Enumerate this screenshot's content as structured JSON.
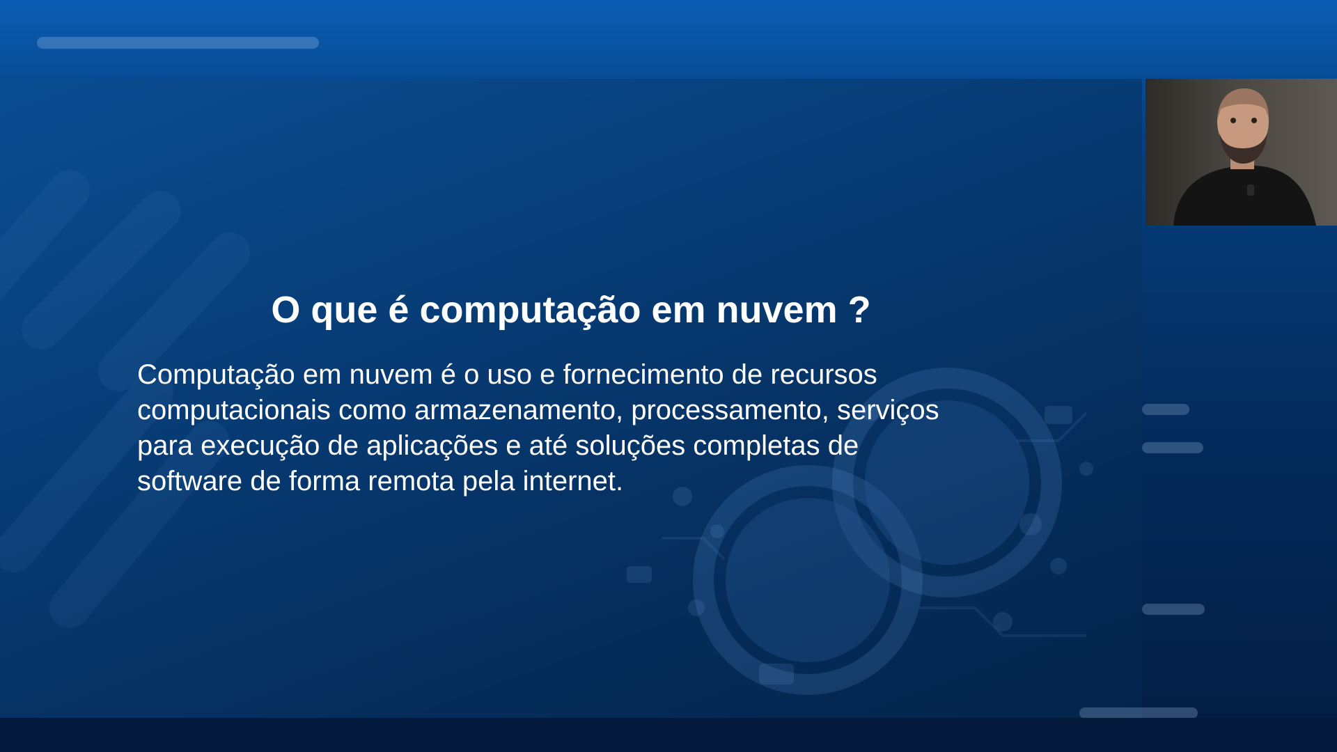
{
  "slide": {
    "title": "O que é computação em nuvem ?",
    "body_lines": [
      "Computação em nuvem é o uso e fornecimento de recursos",
      "computacionais como armazenamento, processamento, serviços",
      "para execução de aplicações e até soluções completas de",
      "software de forma remota pela internet."
    ]
  },
  "colors": {
    "background_top": "#0a5db4",
    "background_bottom": "#031d42",
    "text": "#ffffff"
  },
  "icons": {
    "webcam": "presenter-webcam-feed",
    "background_art": "cloud-circuit-graphic"
  }
}
